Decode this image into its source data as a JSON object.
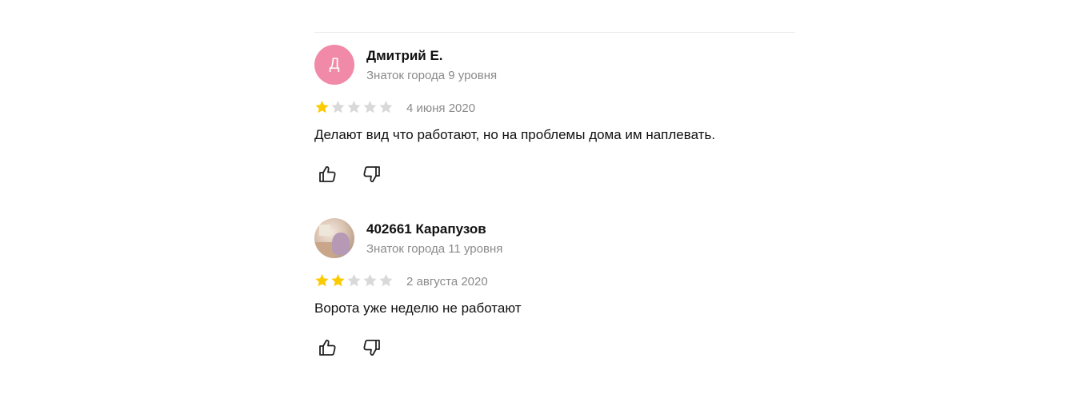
{
  "colors": {
    "star_filled": "#fcca00",
    "star_empty": "#d9d9d9",
    "avatar_letter_bg": "#f08aa8",
    "muted_text": "#8a8a8a"
  },
  "reviews": [
    {
      "avatar_letter": "Д",
      "author": "Дмитрий Е.",
      "level": "Знаток города 9 уровня",
      "rating": 1,
      "rating_max": 5,
      "date": "4 июня 2020",
      "text": "Делают вид что работают, но на проблемы дома им наплевать."
    },
    {
      "avatar_letter": "",
      "author": "402661 Карапузов",
      "level": "Знаток города 11 уровня",
      "rating": 2,
      "rating_max": 5,
      "date": "2 августа 2020",
      "text": "Ворота уже неделю не работают"
    }
  ],
  "icons": {
    "like": "thumbs-up-icon",
    "dislike": "thumbs-down-icon"
  }
}
